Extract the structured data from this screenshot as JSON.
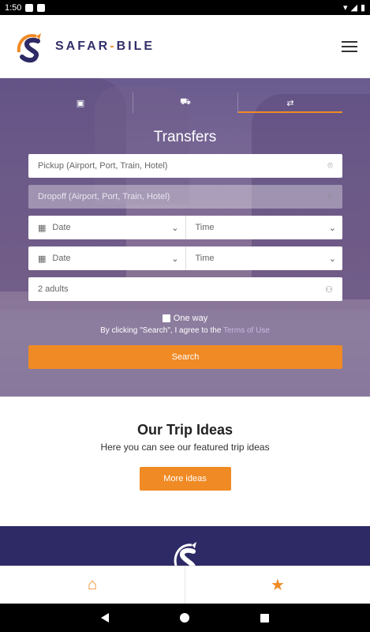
{
  "status_bar": {
    "time": "1:50"
  },
  "header": {
    "logo_left": "SAFAR",
    "logo_dash": "-",
    "logo_right": "BILE"
  },
  "hero": {
    "title": "Transfers",
    "tabs": [
      {
        "icon": "hotel-icon"
      },
      {
        "icon": "car-icon"
      },
      {
        "icon": "transfer-icon",
        "active": true
      }
    ],
    "pickup_placeholder": "Pickup (Airport, Port, Train, Hotel)",
    "dropoff_placeholder": "Dropoff (Airport, Port, Train, Hotel)",
    "date_label": "Date",
    "time_label": "Time",
    "passengers": "2 adults",
    "one_way_label": "One way",
    "terms_prefix": "By clicking \"Search\", I agree to the ",
    "terms_link": "Terms of Use",
    "search_label": "Search"
  },
  "trips": {
    "title": "Our Trip Ideas",
    "subtitle": "Here you can see our featured trip ideas",
    "button": "More ideas"
  },
  "colors": {
    "accent": "#f08a24",
    "brand": "#2e2a66"
  }
}
